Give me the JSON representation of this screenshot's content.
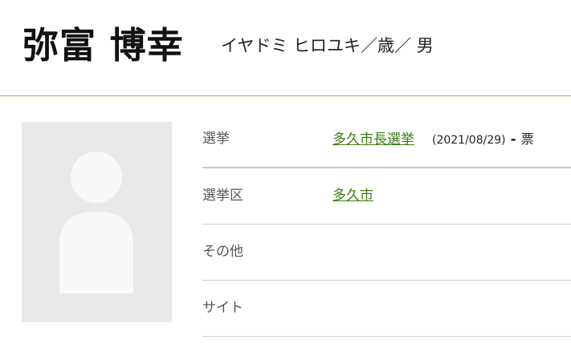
{
  "candidate": {
    "name": "弥富 博幸",
    "subinfo": "イヤドミ ヒロユキ／歳／ 男"
  },
  "photo": {
    "icon": "person-placeholder-icon"
  },
  "details": {
    "election": {
      "label": "選挙",
      "link": "多久市長選挙",
      "date": "(2021/08/29)",
      "dash": "-",
      "votes": "票"
    },
    "district": {
      "label": "選挙区",
      "link": "多久市"
    },
    "other": {
      "label": "その他"
    },
    "site": {
      "label": "サイト"
    }
  },
  "colors": {
    "accent_line": "#8cc06b",
    "link": "#3c7d14",
    "photo_bg": "#e9e9e7"
  }
}
